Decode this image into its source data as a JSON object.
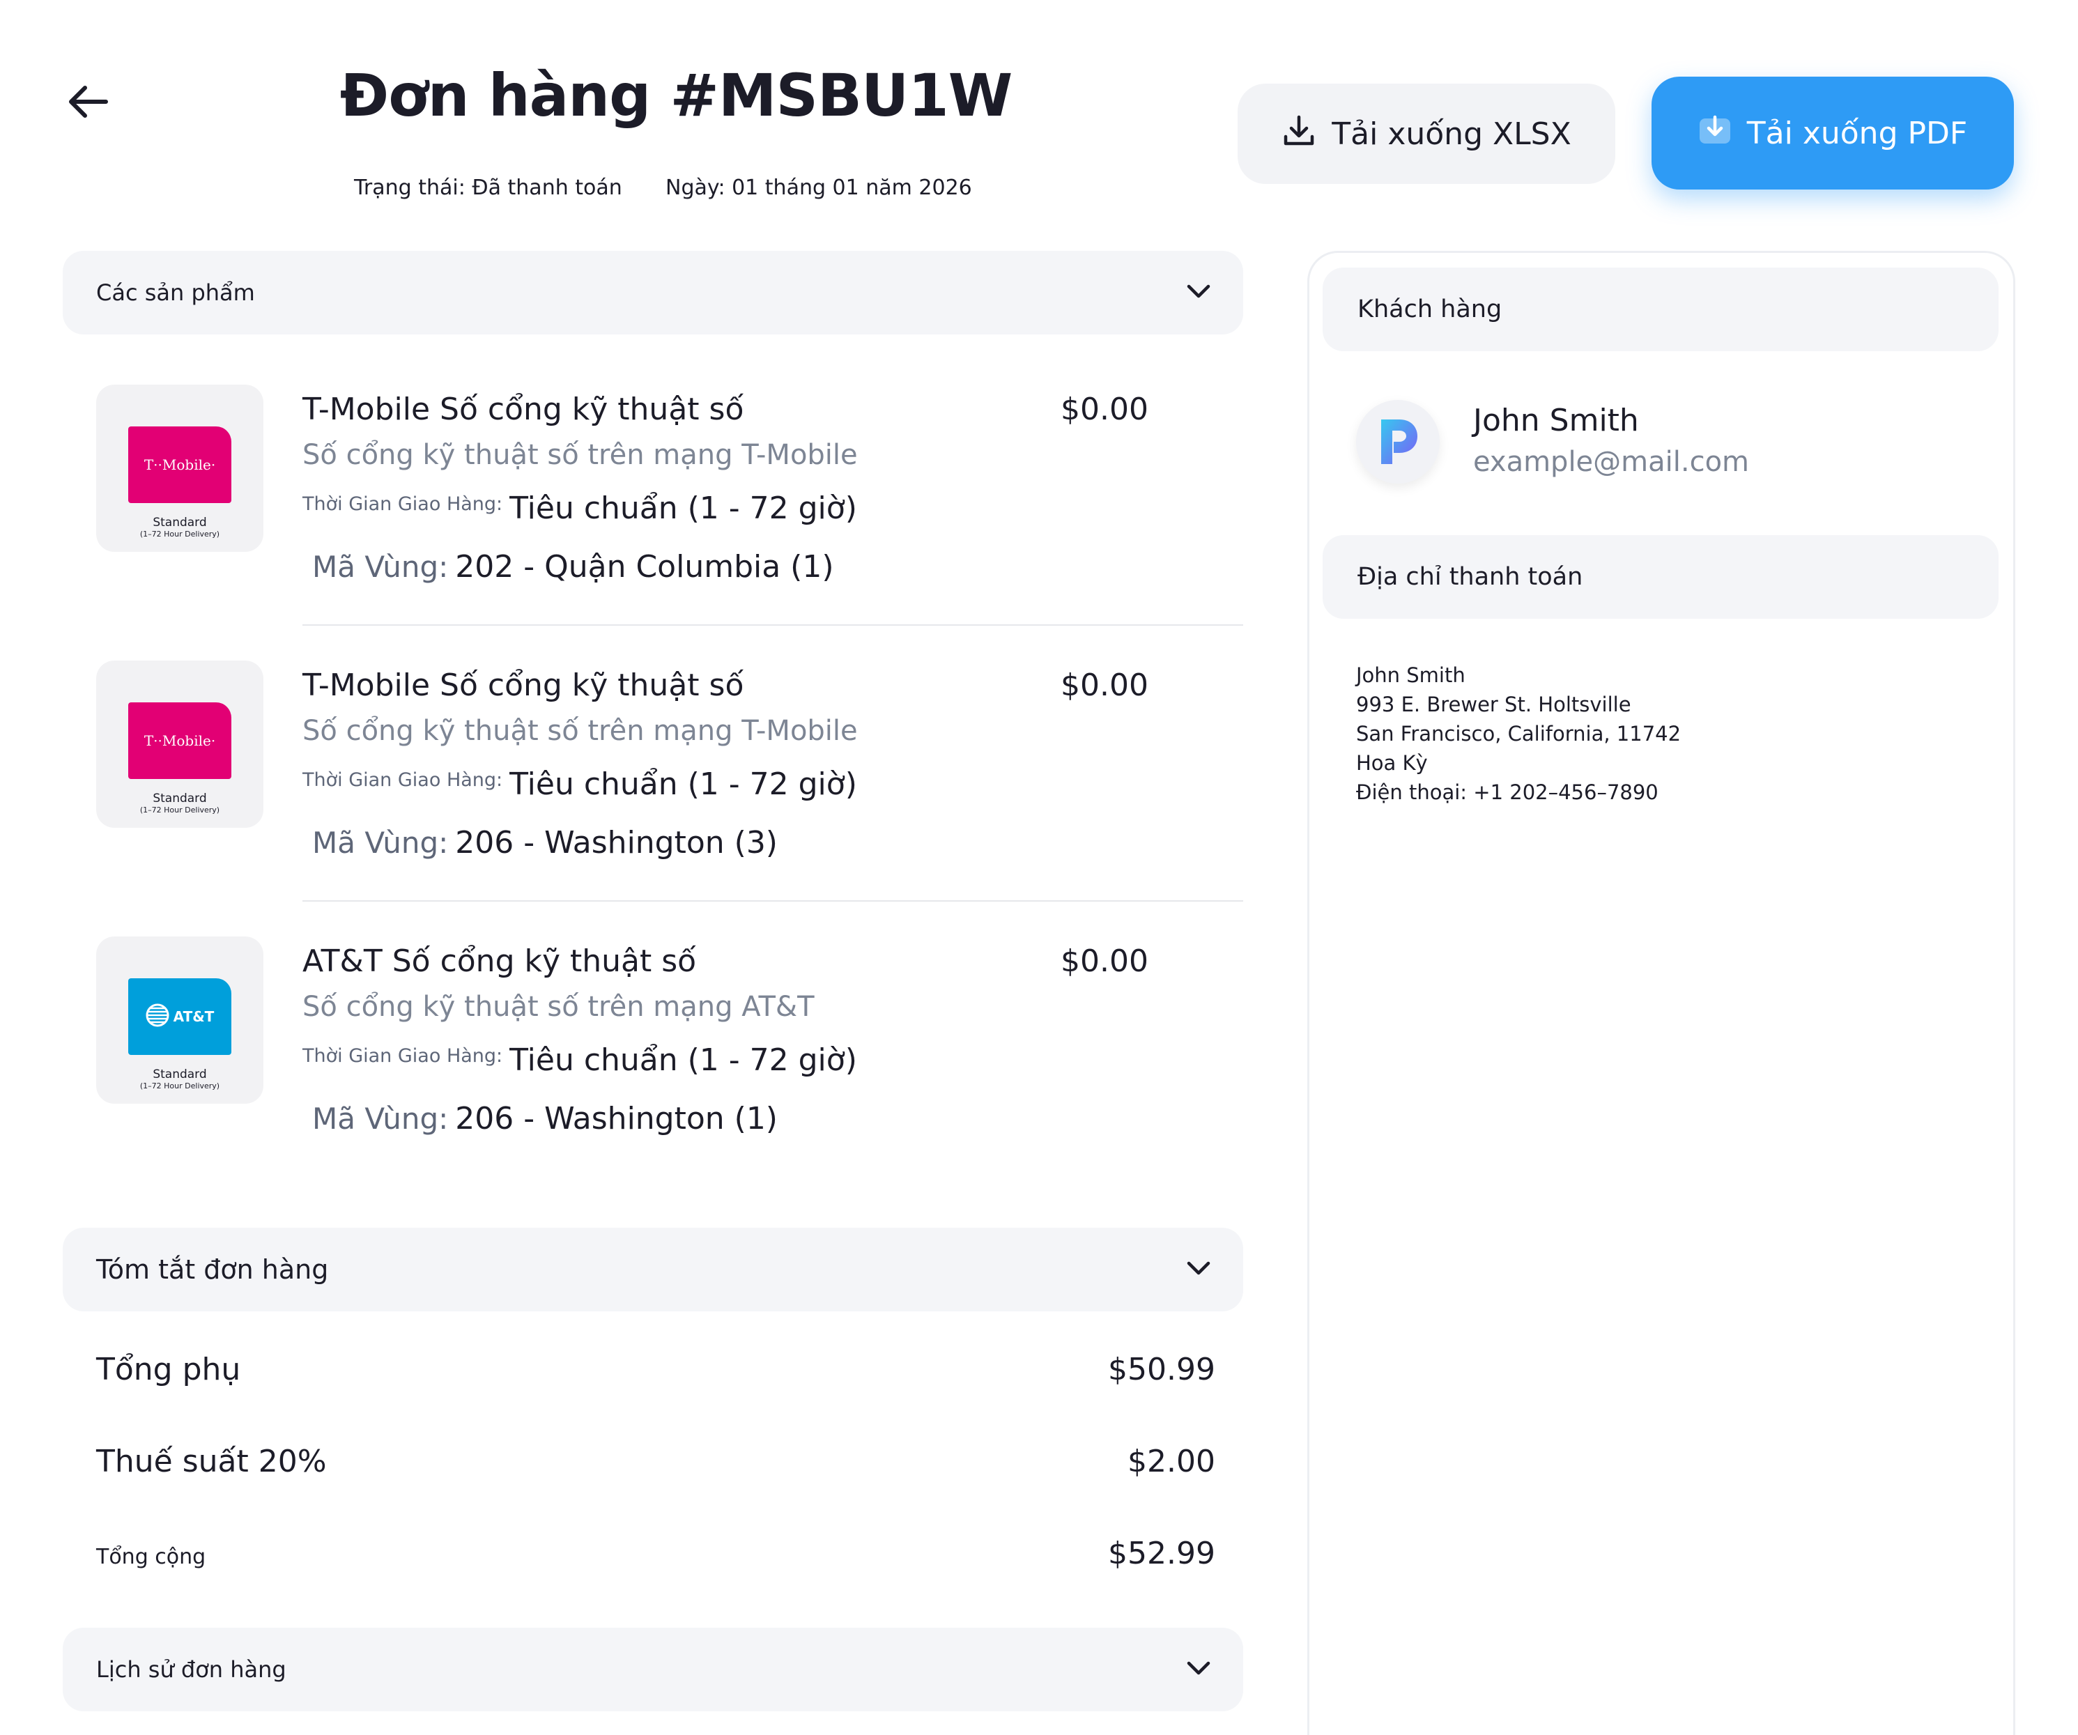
{
  "header": {
    "title": "Đơn hàng #MSBU1W",
    "status": "Trạng thái: Đã thanh toán",
    "date": "Ngày: 01 tháng 01 năm 2026",
    "download_xlsx": "Tải xuống XLSX",
    "download_pdf": "Tải xuống PDF"
  },
  "products_section": {
    "title": "Các sản phẩm",
    "items": [
      {
        "name": "T-Mobile Số cổng kỹ thuật số",
        "price": "$0.00",
        "description": "Số cổng kỹ thuật số trên mạng T-Mobile",
        "delivery_label": "Thời Gian Giao Hàng:",
        "delivery_value": "Tiêu chuẩn (1 - 72 giờ)",
        "area_label": "Mã Vùng:",
        "area_value": "202 - Quận Columbia (1)",
        "sim_brand": "T··Mobile·",
        "sim_line1": "Standard",
        "sim_line2": "(1–72 Hour Delivery)",
        "sim_color": "#e20074"
      },
      {
        "name": "T-Mobile Số cổng kỹ thuật số",
        "price": "$0.00",
        "description": "Số cổng kỹ thuật số trên mạng T-Mobile",
        "delivery_label": "Thời Gian Giao Hàng:",
        "delivery_value": "Tiêu chuẩn (1 - 72 giờ)",
        "area_label": "Mã Vùng:",
        "area_value": "206 - Washington (3)",
        "sim_brand": "T··Mobile·",
        "sim_line1": "Standard",
        "sim_line2": "(1–72 Hour Delivery)",
        "sim_color": "#e20074"
      },
      {
        "name": "AT&T Số cổng kỹ thuật số",
        "price": "$0.00",
        "description": "Số cổng kỹ thuật số trên mạng AT&T",
        "delivery_label": "Thời Gian Giao Hàng:",
        "delivery_value": "Tiêu chuẩn (1 - 72 giờ)",
        "area_label": "Mã Vùng:",
        "area_value": "206 - Washington (1)",
        "sim_brand": "AT&T",
        "sim_line1": "Standard",
        "sim_line2": "(1–72 Hour Delivery)",
        "sim_color": "#009fdb"
      }
    ]
  },
  "summary": {
    "title": "Tóm tắt đơn hàng",
    "subtotal_label": "Tổng phụ",
    "subtotal_value": "$50.99",
    "tax_label": "Thuế suất 20%",
    "tax_value": "$2.00",
    "total_label": "Tổng cộng",
    "total_value": "$52.99"
  },
  "history": {
    "title": "Lịch sử đơn hàng"
  },
  "customer": {
    "section_title": "Khách hàng",
    "name": "John Smith",
    "email": "example@mail.com"
  },
  "billing": {
    "section_title": "Địa chỉ thanh toán",
    "lines": [
      "John Smith",
      "993 E. Brewer St. Holtsville",
      "San Francisco, California, 11742",
      "Hoa Kỳ",
      "Điện thoại: +1 202–456–7890"
    ]
  },
  "colors": {
    "accent": "#2e9bf5",
    "section_bg": "#f4f5f8",
    "muted_text": "#7d8594"
  },
  "icons": {
    "back": "arrow-left-icon",
    "download": "download-icon",
    "chevron": "chevron-down-icon",
    "avatar": "brand-logo-icon"
  }
}
